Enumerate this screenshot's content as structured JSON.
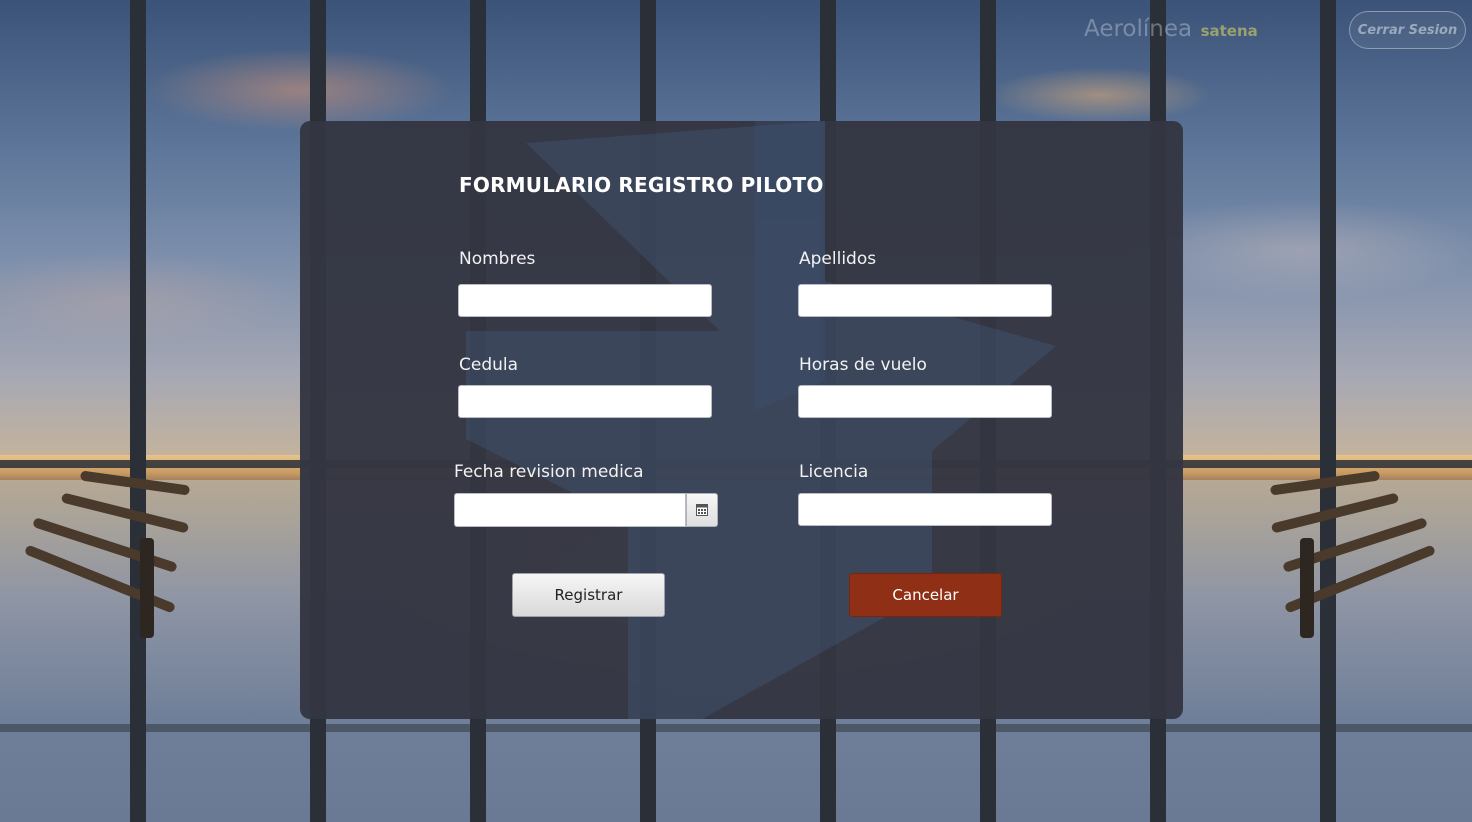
{
  "header": {
    "brand_prefix": "Aerolínea",
    "brand_name": "satena",
    "logout_label": "Cerrar Sesion"
  },
  "form": {
    "title": "FORMULARIO REGISTRO PILOTO",
    "fields": {
      "nombres": {
        "label": "Nombres",
        "value": ""
      },
      "apellidos": {
        "label": "Apellidos",
        "value": ""
      },
      "cedula": {
        "label": "Cedula",
        "value": ""
      },
      "horas_vuelo": {
        "label": "Horas de vuelo",
        "value": ""
      },
      "fecha_revision": {
        "label": "Fecha revision medica",
        "value": ""
      },
      "licencia": {
        "label": "Licencia",
        "value": ""
      }
    },
    "buttons": {
      "register_label": "Registrar",
      "cancel_label": "Cancelar"
    }
  },
  "colors": {
    "panel_bg": "#343642",
    "cancel_button": "#8f2f15",
    "brand_accent": "#9aa070"
  },
  "icons": {
    "date_picker": "calendar-icon"
  }
}
